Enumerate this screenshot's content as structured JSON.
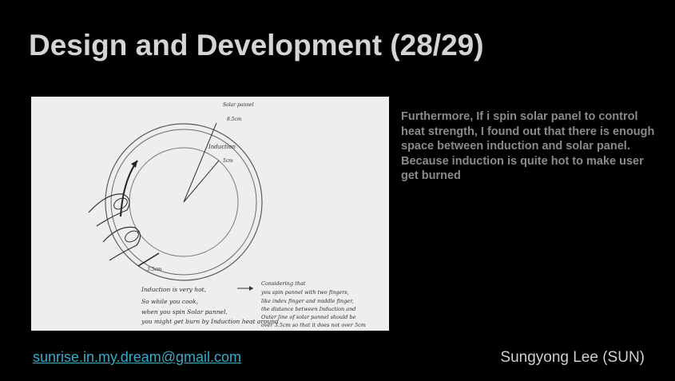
{
  "slide": {
    "title": "Design and Development (28/29)",
    "body_text": "Furthermore, If i spin solar panel to control heat strength, I found out that there is enough space between induction and solar panel. Because induction is quite hot to make user get burned",
    "footer_email": "sunrise.in.my.dream@gmail.com",
    "footer_author": "Sungyong Lee (SUN)"
  },
  "sketch": {
    "label_solar_panel": "Solar pannel",
    "label_solar_size": "8.5cm",
    "label_induction": "Induction",
    "label_induction_size": "5cm",
    "label_gap_size": "3.5cm",
    "note_left": [
      "Induction is very hot,",
      "So while you cook,",
      "when you spin Solar pannel,",
      "you might get burn by Induction heat around"
    ],
    "note_right": [
      "Considering that",
      "you spin pannel with two fingers,",
      "like index finger and middle finger,",
      "the distance between Induction and",
      "Outer line of solar pannel should be",
      "over 3.5cm so that it does not over 5cm"
    ]
  },
  "colors": {
    "background": "#000000",
    "title": "#d4d4d4",
    "body_text": "#8a8a8a",
    "link": "#3aa9c9",
    "author": "#cfcfcf",
    "paper": "#eceef0"
  }
}
